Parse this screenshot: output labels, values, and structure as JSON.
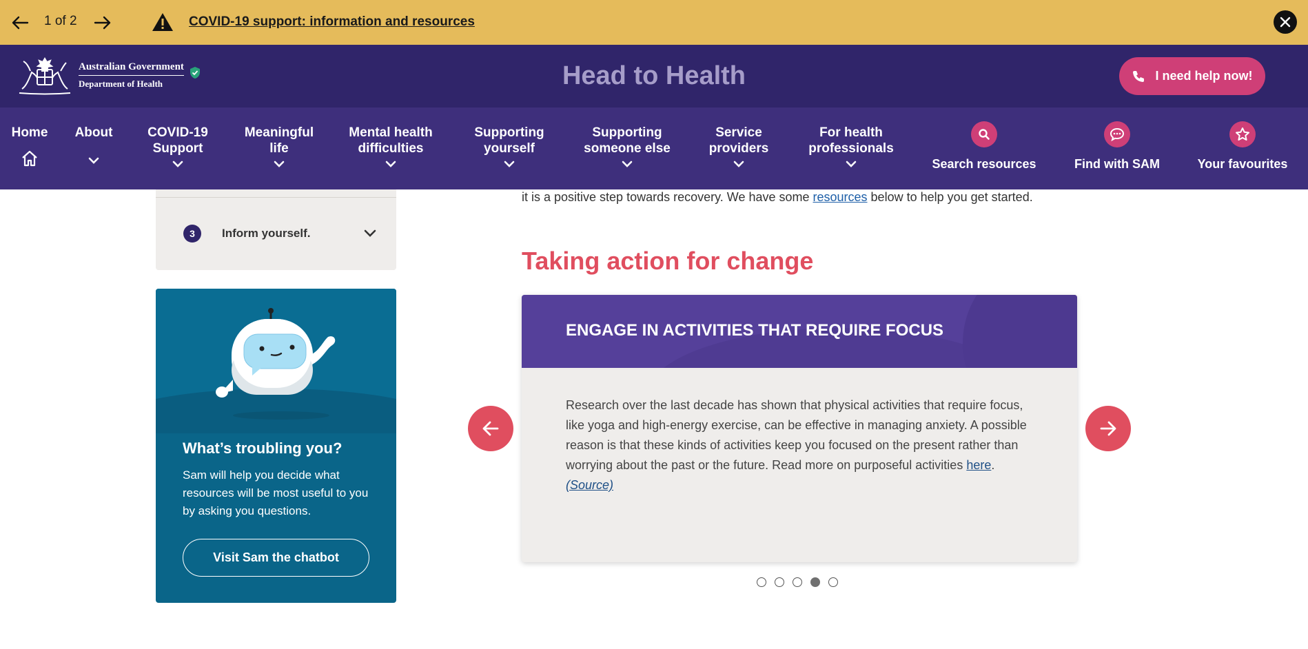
{
  "alert": {
    "counter": "1 of 2",
    "link_text": "COVID-19 support: information and resources"
  },
  "header": {
    "gov_line1": "Australian Government",
    "gov_line2": "Department of Health",
    "site_title": "Head to Health",
    "help_button": "I need help now!"
  },
  "nav": {
    "items": [
      {
        "label": "Home"
      },
      {
        "label": "About"
      },
      {
        "label": "COVID-19 Support"
      },
      {
        "label": "Meaningful life"
      },
      {
        "label": "Mental health difficulties"
      },
      {
        "label": "Supporting yourself"
      },
      {
        "label": "Supporting someone else"
      },
      {
        "label": "Service providers"
      },
      {
        "label": "For health professionals"
      }
    ],
    "tools": [
      {
        "label": "Search resources",
        "icon": "search-icon"
      },
      {
        "label": "Find with SAM",
        "icon": "chat-icon"
      },
      {
        "label": "Your favourites",
        "icon": "star-icon"
      }
    ]
  },
  "sidebar": {
    "accordion_item": {
      "number": "3",
      "label": "Inform yourself."
    },
    "sam": {
      "title": "What’s troubling you?",
      "description": "Sam will help you decide what resources will be most useful to you by asking you questions.",
      "button": "Visit Sam the chatbot"
    }
  },
  "main": {
    "intro_before": "it is a positive step towards recovery. We have some ",
    "intro_link": "resources",
    "intro_after": " below to help you get started.",
    "section_title": "Taking action for change",
    "card": {
      "title": "ENGAGE IN ACTIVITIES THAT REQUIRE FOCUS",
      "body": "Research over the last decade has shown that physical activities that require focus, like yoga and high-energy exercise, can be effective in managing anxiety. A possible reason is that these kinds of activities keep you focused on the present rather than worrying about the past or the future. Read more on purposeful activities ",
      "link_here": "here",
      "period": ".",
      "link_source": "(Source)"
    },
    "carousel": {
      "total_slides": 5,
      "active_slide": 4
    }
  },
  "colors": {
    "alert_bg": "#e5bb5b",
    "header_bg": "#30256a",
    "nav_bg": "#3e2f7c",
    "accent_pink": "#cf3f77",
    "accent_red": "#e04e5f",
    "card_header": "#55409a",
    "sam_card": "#0a6589"
  }
}
